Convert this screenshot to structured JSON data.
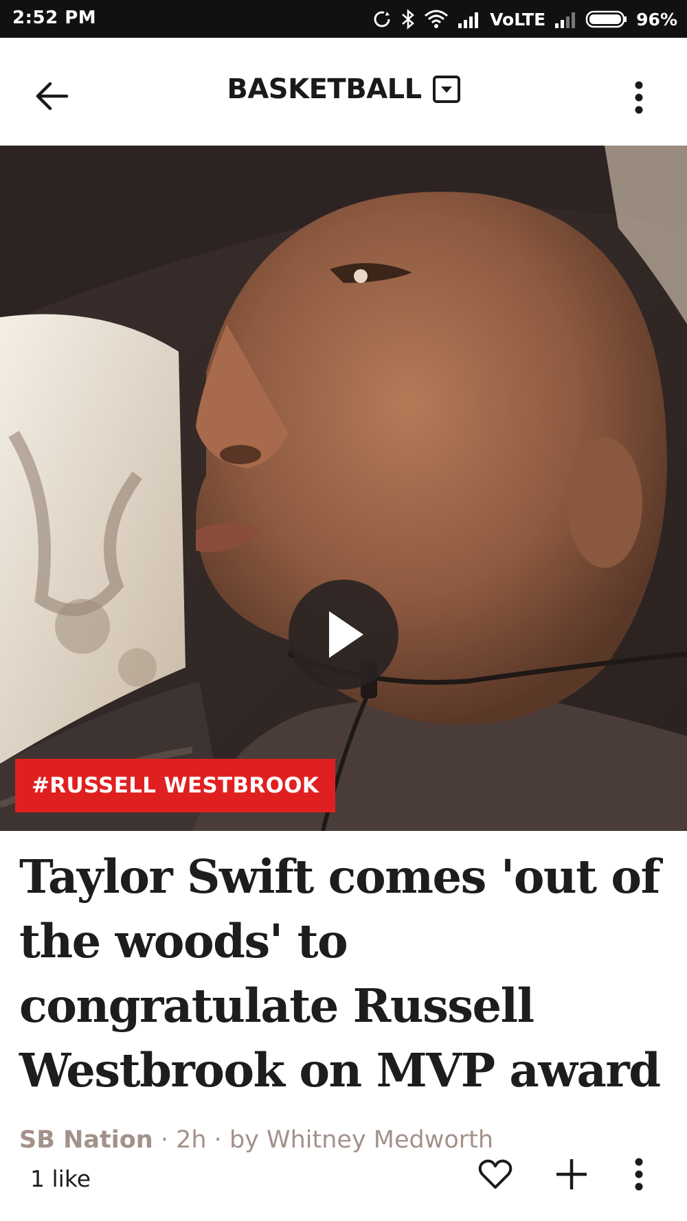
{
  "status_bar": {
    "time": "2:52 PM",
    "network": "VoLTE",
    "battery": "96%",
    "icons": [
      "sync-icon",
      "bluetooth-icon",
      "wifi-icon",
      "signal-icon",
      "signal-icon",
      "battery-icon"
    ]
  },
  "app_bar": {
    "title": "BASKETBALL",
    "icons": [
      "back-arrow-icon",
      "dropdown-icon",
      "more-vertical-icon"
    ]
  },
  "hero": {
    "tag": "#RUSSELL WESTBROOK",
    "play_icon": "play-icon",
    "colors": {
      "tag_background": "#e02020",
      "play_background": "#282222"
    }
  },
  "article": {
    "headline": "Taylor Swift comes 'out of the woods' to congratulate Russell Westbrook on MVP award",
    "source": "SB Nation",
    "age": "2h",
    "author_prefix": "by",
    "author": "Whitney Medworth",
    "likes": "1 like",
    "colors": {
      "byline": "#a3918a"
    }
  },
  "actions": {
    "icons": [
      "heart-icon",
      "plus-icon",
      "more-vertical-icon"
    ]
  }
}
